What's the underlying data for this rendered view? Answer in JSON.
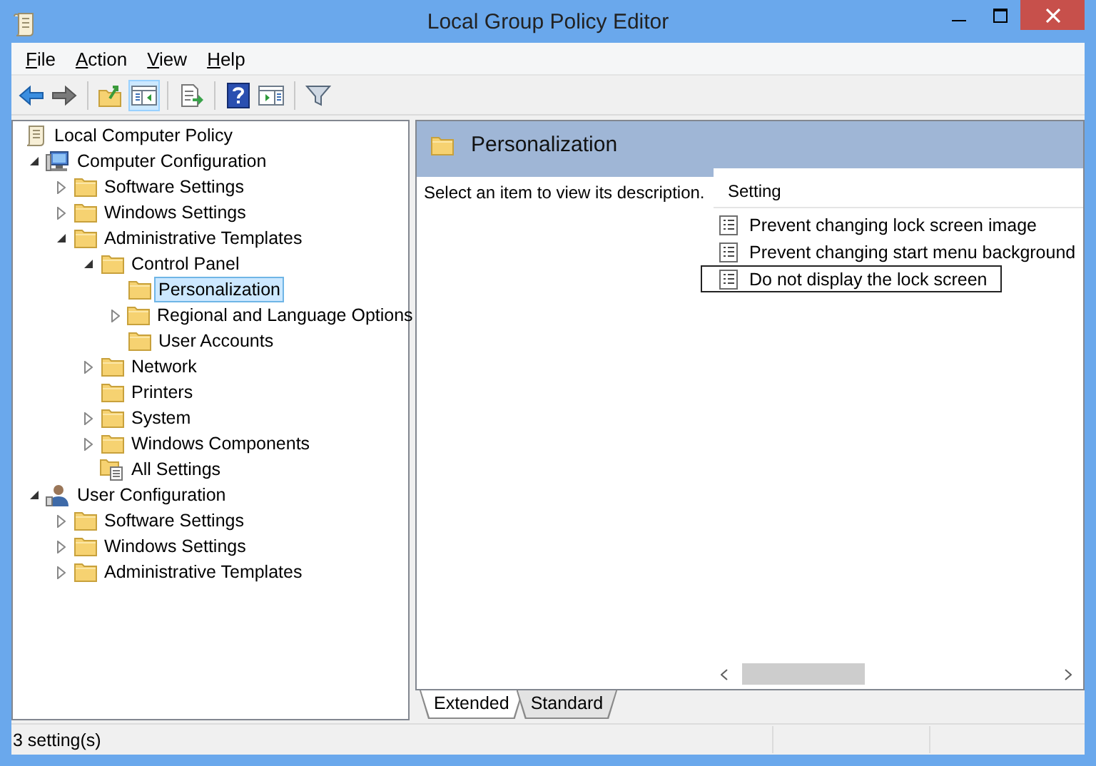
{
  "window": {
    "title": "Local Group Policy Editor"
  },
  "menu": [
    "File",
    "Action",
    "View",
    "Help"
  ],
  "toolbar": [
    {
      "kind": "back",
      "pressed": false
    },
    {
      "kind": "forward",
      "pressed": false
    },
    {
      "kind": "separator"
    },
    {
      "kind": "up",
      "pressed": false
    },
    {
      "kind": "tree-toggle",
      "pressed": true
    },
    {
      "kind": "separator"
    },
    {
      "kind": "export",
      "pressed": false
    },
    {
      "kind": "separator"
    },
    {
      "kind": "help",
      "pressed": false
    },
    {
      "kind": "action-pane",
      "pressed": false
    },
    {
      "kind": "separator"
    },
    {
      "kind": "filter",
      "pressed": false
    }
  ],
  "tree": [
    {
      "label": "Local Computer Policy",
      "kind": "policy",
      "selected": false,
      "children": [
        {
          "label": "Computer Configuration",
          "kind": "computer",
          "selected": false,
          "expanded": true,
          "children": [
            {
              "label": "Software Settings",
              "kind": "folder",
              "selected": false,
              "expanded": false
            },
            {
              "label": "Windows Settings",
              "kind": "folder",
              "selected": false,
              "expanded": false
            },
            {
              "label": "Administrative Templates",
              "kind": "folder",
              "selected": false,
              "expanded": true,
              "children": [
                {
                  "label": "Control Panel",
                  "kind": "folder",
                  "selected": false,
                  "expanded": true,
                  "children": [
                    {
                      "label": "Personalization",
                      "kind": "folder",
                      "selected": true
                    },
                    {
                      "label": "Regional and Language Options",
                      "kind": "folder",
                      "selected": false,
                      "expanded": false
                    },
                    {
                      "label": "User Accounts",
                      "kind": "folder",
                      "selected": false
                    }
                  ]
                },
                {
                  "label": "Network",
                  "kind": "folder",
                  "selected": false,
                  "expanded": false
                },
                {
                  "label": "Printers",
                  "kind": "folder",
                  "selected": false
                },
                {
                  "label": "System",
                  "kind": "folder",
                  "selected": false,
                  "expanded": false
                },
                {
                  "label": "Windows Components",
                  "kind": "folder",
                  "selected": false,
                  "expanded": false
                },
                {
                  "label": "All Settings",
                  "kind": "all-settings",
                  "selected": false
                }
              ]
            }
          ]
        },
        {
          "label": "User Configuration",
          "kind": "user",
          "selected": false,
          "expanded": true,
          "children": [
            {
              "label": "Software Settings",
              "kind": "folder",
              "selected": false,
              "expanded": false
            },
            {
              "label": "Windows Settings",
              "kind": "folder",
              "selected": false,
              "expanded": false
            },
            {
              "label": "Administrative Templates",
              "kind": "folder",
              "selected": false,
              "expanded": false
            }
          ]
        }
      ]
    }
  ],
  "details": {
    "title": "Personalization",
    "description": "Select an item to view its description.",
    "column": "Setting",
    "items": [
      {
        "label": "Prevent changing lock screen image",
        "focused": false
      },
      {
        "label": "Prevent changing start menu background",
        "focused": false
      },
      {
        "label": "Do not display the lock screen",
        "focused": true
      }
    ]
  },
  "tabs": [
    {
      "label": "Extended",
      "selected": true
    },
    {
      "label": "Standard",
      "selected": false
    }
  ],
  "status_bar": {
    "text": "3 setting(s)"
  }
}
